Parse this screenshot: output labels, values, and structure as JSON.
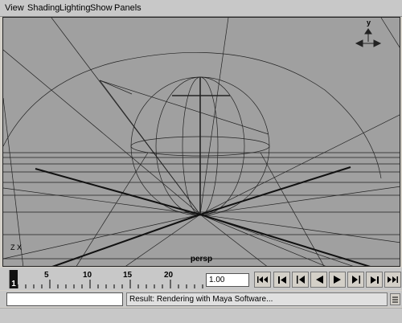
{
  "menubar": {
    "items": [
      {
        "label": "View"
      },
      {
        "label": "Shading"
      },
      {
        "label": "Lighting"
      },
      {
        "label": "Show"
      },
      {
        "label": "Panels"
      }
    ]
  },
  "viewport": {
    "camera_label": "persp",
    "axis_indicator": "Z   X",
    "view_cube_axis": "y",
    "background_color": "#a0a0a0"
  },
  "timeline": {
    "current_frame": "1",
    "tick_labels": [
      "5",
      "10",
      "15",
      "20"
    ],
    "current_time_value": "1.00"
  },
  "playback": {
    "buttons": [
      {
        "name": "go-to-start-icon"
      },
      {
        "name": "step-back-key-icon"
      },
      {
        "name": "step-back-frame-icon"
      },
      {
        "name": "play-backward-icon"
      },
      {
        "name": "play-forward-icon"
      },
      {
        "name": "step-forward-frame-icon"
      },
      {
        "name": "step-forward-key-icon"
      },
      {
        "name": "go-to-end-icon"
      }
    ]
  },
  "command_line": {
    "input_value": "",
    "result_text": "Result: Rendering with Maya Software..."
  }
}
